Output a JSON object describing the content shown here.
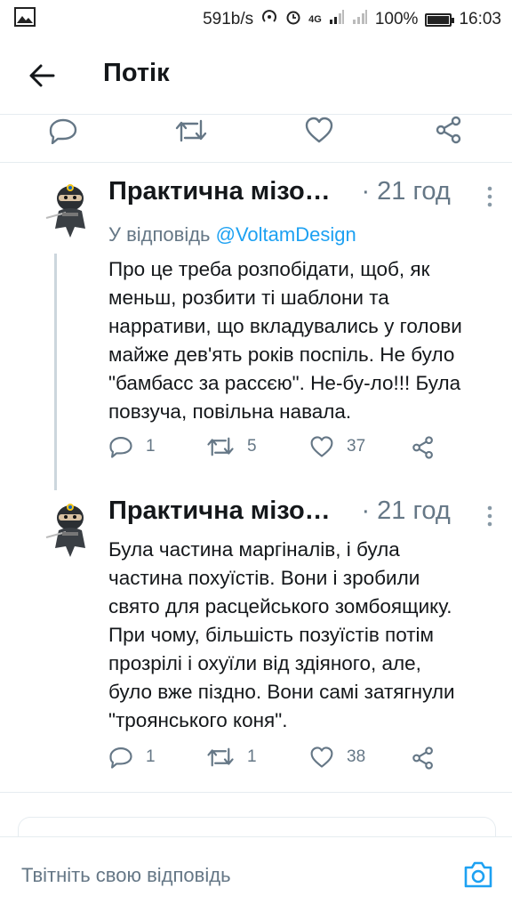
{
  "status_bar": {
    "speed": "591b/s",
    "network": "4G",
    "battery_text": "100%",
    "battery_level": 1.0,
    "time": "16:03"
  },
  "header": {
    "title": "Потік",
    "back_icon": "arrow-left-icon"
  },
  "colors": {
    "accent": "#1da1f2",
    "secondary_text": "#657786",
    "primary_text": "#14171a",
    "divider": "#e6ecf0"
  },
  "tweets": [
    {
      "name": "Практична мізо…",
      "time": "· 21 год",
      "reply_prefix": "У відповідь ",
      "reply_handle": "@VoltamDesign",
      "text": "Про це треба розпобідати, щоб, як\nменьш, розбити ті шаблони та\nнарративи, що вкладувались у голови\nмайже дев'ять років поспіль. Не було\n\"бамбасс за рассєю\". Не-бу-ло!!! Була\nповзуча, повільна навала.",
      "replies": "1",
      "retweets": "5",
      "likes": "37"
    },
    {
      "name": "Практична мізо…",
      "time": "· 21 год",
      "text": "Була частина маргіналів, і була\nчастина похуїстів. Вони і зробили\nсвято для расцейського зомбоящику.\nПри чому, більшість позуїстів потім\nпрозрілі і охуїли від здіяного, але,\nбуло вже піздно. Вони самі затягнули\n\"троянського коня\".",
      "replies": "1",
      "retweets": "1",
      "likes": "38"
    }
  ],
  "reply_bar": {
    "placeholder": "Твітніть свою відповідь",
    "camera_icon": "camera-icon"
  }
}
